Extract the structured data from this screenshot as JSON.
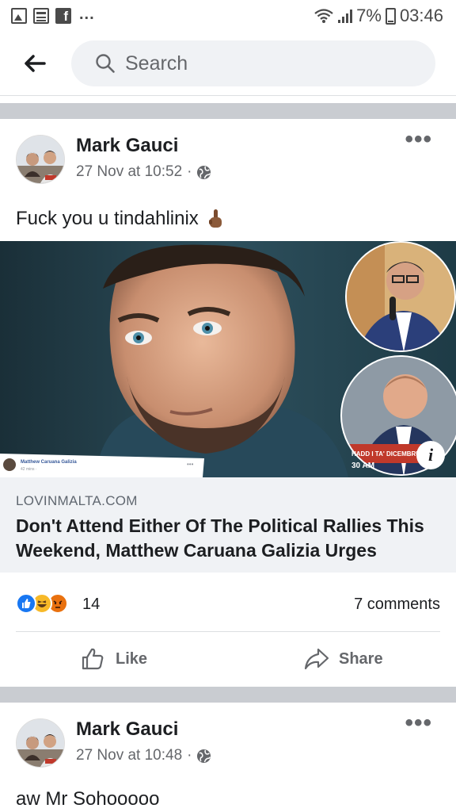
{
  "status_bar": {
    "more": "...",
    "battery": "7%",
    "time": "03:46"
  },
  "search": {
    "placeholder": "Search"
  },
  "posts": [
    {
      "author": "Mark Gauci",
      "time": "27 Nov at 10:52",
      "privacy_icon": "globe-icon",
      "text": "Fuck you u tindahlinix",
      "emoji": "middle-finger",
      "link": {
        "domain": "LOVINMALTA.COM",
        "title": "Don't Attend Either Of The Political Rallies This Weekend, Matthew Caruana Galizia Urges",
        "inset_name": "Matthew Caruana Galizia",
        "inset_meta": "42 mins · ",
        "banner": "HADD I TA' DICEMBRU",
        "banner_time": "30 AM"
      },
      "reaction_count": "14",
      "comments": "7 comments",
      "like_label": "Like",
      "share_label": "Share"
    },
    {
      "author": "Mark Gauci",
      "time": "27 Nov at 10:48",
      "privacy_icon": "globe-icon",
      "text": "aw Mr Sohooooo"
    }
  ],
  "colors": {
    "like_blue": "#1877f2",
    "haha_yellow": "#f7b928",
    "angry_orange": "#e9710f",
    "divider_gray": "#c9ccd1",
    "link_bg": "#f0f2f5"
  }
}
